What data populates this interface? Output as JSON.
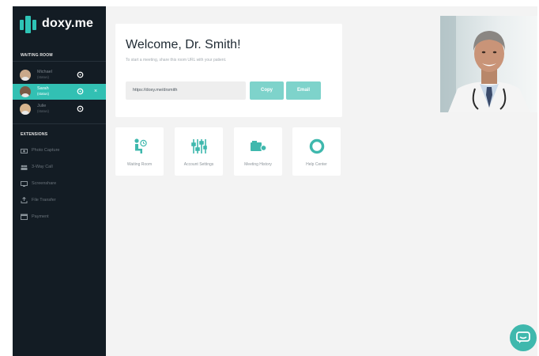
{
  "app": {
    "logo_text": "doxy.me",
    "brand_color": "#2ec4b6",
    "sidebar_color": "#131c24"
  },
  "sidebar": {
    "waiting_room_title": "WAITING ROOM",
    "patients": [
      {
        "name": "Michael",
        "status": "(status)",
        "active": false
      },
      {
        "name": "Sarah",
        "status": "(status)",
        "active": true
      },
      {
        "name": "Julie",
        "status": "(status)",
        "active": false
      }
    ],
    "extensions_title": "EXTENSIONS",
    "extensions": [
      {
        "label": "Photo Capture",
        "icon": "camera-icon"
      },
      {
        "label": "3-Way Call",
        "icon": "group-icon"
      },
      {
        "label": "Screenshare",
        "icon": "monitor-icon"
      },
      {
        "label": "File Transfer",
        "icon": "upload-icon"
      },
      {
        "label": "Payment",
        "icon": "payment-icon"
      }
    ]
  },
  "welcome": {
    "title": "Welcome, Dr. Smith!",
    "subtitle": "To start a meeting, share this room URL with your patient.",
    "room_url": "https://doxy.me/drsmith",
    "copy_label": "Copy",
    "email_label": "Email"
  },
  "tiles": [
    {
      "label": "Waiting Room",
      "icon": "waiting-room-icon"
    },
    {
      "label": "Account Settings",
      "icon": "sliders-icon"
    },
    {
      "label": "Meeting History",
      "icon": "camera-film-icon"
    },
    {
      "label": "Help Center",
      "icon": "lifebuoy-icon"
    }
  ],
  "chat": {
    "icon": "chat-bubble-icon"
  }
}
